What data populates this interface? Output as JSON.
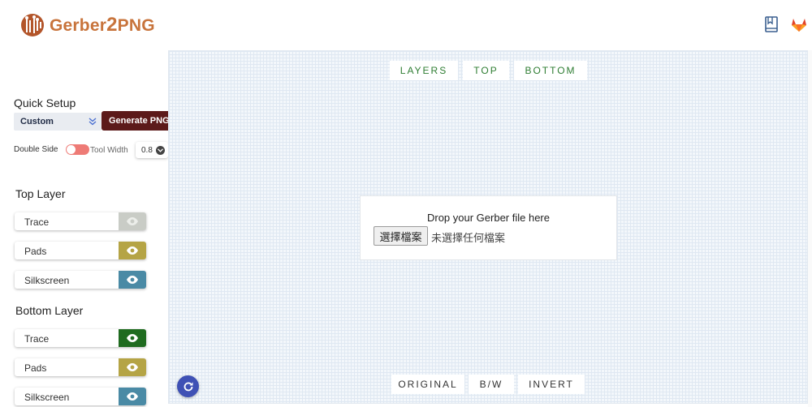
{
  "header": {
    "brand_left": "Gerber",
    "brand_mid": "2",
    "brand_right": "PNG",
    "icons": [
      "book-icon",
      "gitlab-icon"
    ]
  },
  "sidebar": {
    "quick_setup_title": "Quick Setup",
    "preset_value": "Custom",
    "generate_label": "Generate PNG",
    "double_side_label": "Double Side",
    "tool_width_label": "Tool Width",
    "tool_width_value": "0.8",
    "top_layer_title": "Top Layer",
    "top_layers": [
      {
        "label": "Trace",
        "color": "#c9ccc6",
        "visible": false
      },
      {
        "label": "Pads",
        "color": "#b5a445",
        "visible": true
      },
      {
        "label": "Silkscreen",
        "color": "#4a8aa5",
        "visible": true
      }
    ],
    "bottom_layer_title": "Bottom Layer",
    "bottom_layers": [
      {
        "label": "Trace",
        "color": "#1f6b1f",
        "visible": true
      },
      {
        "label": "Pads",
        "color": "#b5a445",
        "visible": true
      },
      {
        "label": "Silkscreen",
        "color": "#4a8aa5",
        "visible": true
      }
    ]
  },
  "canvas": {
    "view_tabs": [
      "LAYERS",
      "TOP",
      "BOTTOM"
    ],
    "drop_message": "Drop your Gerber file here",
    "file_button": "選擇檔案",
    "file_status": "未選擇任何檔案",
    "color_modes": [
      "ORIGINAL",
      "B/W",
      "INVERT"
    ]
  },
  "colors": {
    "brand": "#c8743c",
    "generate_button": "#5c1a1a",
    "toggle": "#ee7b76",
    "tab_text": "#2e7d32",
    "refresh_button": "#3f51b5"
  }
}
